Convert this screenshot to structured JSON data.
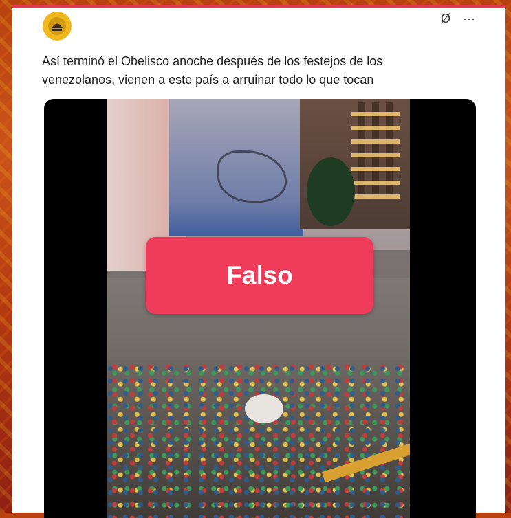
{
  "post": {
    "text": "Así terminó el Obelisco anoche después de los festejos de los venezolanos, vienen a este país a arruinar todo lo que tocan",
    "actions": {
      "grok_icon": "Ø",
      "more_icon": "···"
    }
  },
  "media": {
    "verdict_label": "Falso"
  },
  "colors": {
    "accent": "#e23a55",
    "verdict_bg": "#ef3c5b"
  }
}
